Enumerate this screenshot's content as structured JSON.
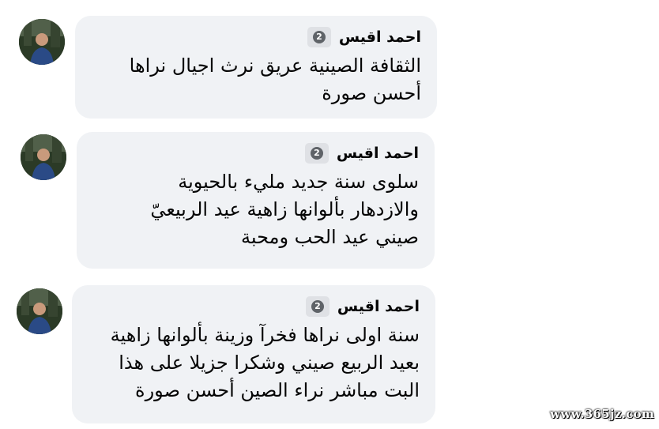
{
  "top_fragment": "",
  "comments": [
    {
      "author": "احمد اقيس",
      "badge_icon": "top-fan-badge-icon",
      "badge_text": "2",
      "lines": [
        "الثقافة الصينية عريق نرث اجيال نراها",
        "أحسن صورة"
      ]
    },
    {
      "author": "احمد اقيس",
      "badge_icon": "top-fan-badge-icon",
      "badge_text": "2",
      "lines": [
        "سلوى سنة جديد مليء بالحيوية",
        "والازدهار بألوانها زاهية عيد الربيعيّ",
        "صيني عيد الحب ومحبة"
      ]
    },
    {
      "author": "احمد اقيس",
      "badge_icon": "top-fan-badge-icon",
      "badge_text": "2",
      "lines": [
        "سنة اولى نراها فخرآ وزينة بألوانها زاهية",
        "بعيد الربيع صيني وشكرا جزيلا على هذا",
        "البت مباشر نراء الصين أحسن صورة"
      ]
    }
  ],
  "watermark": "www.365jz.com",
  "colors": {
    "bubble": "#f0f2f5",
    "text": "#050505",
    "badge_bg": "#dfe1e5",
    "badge_dot": "#5f6368"
  }
}
